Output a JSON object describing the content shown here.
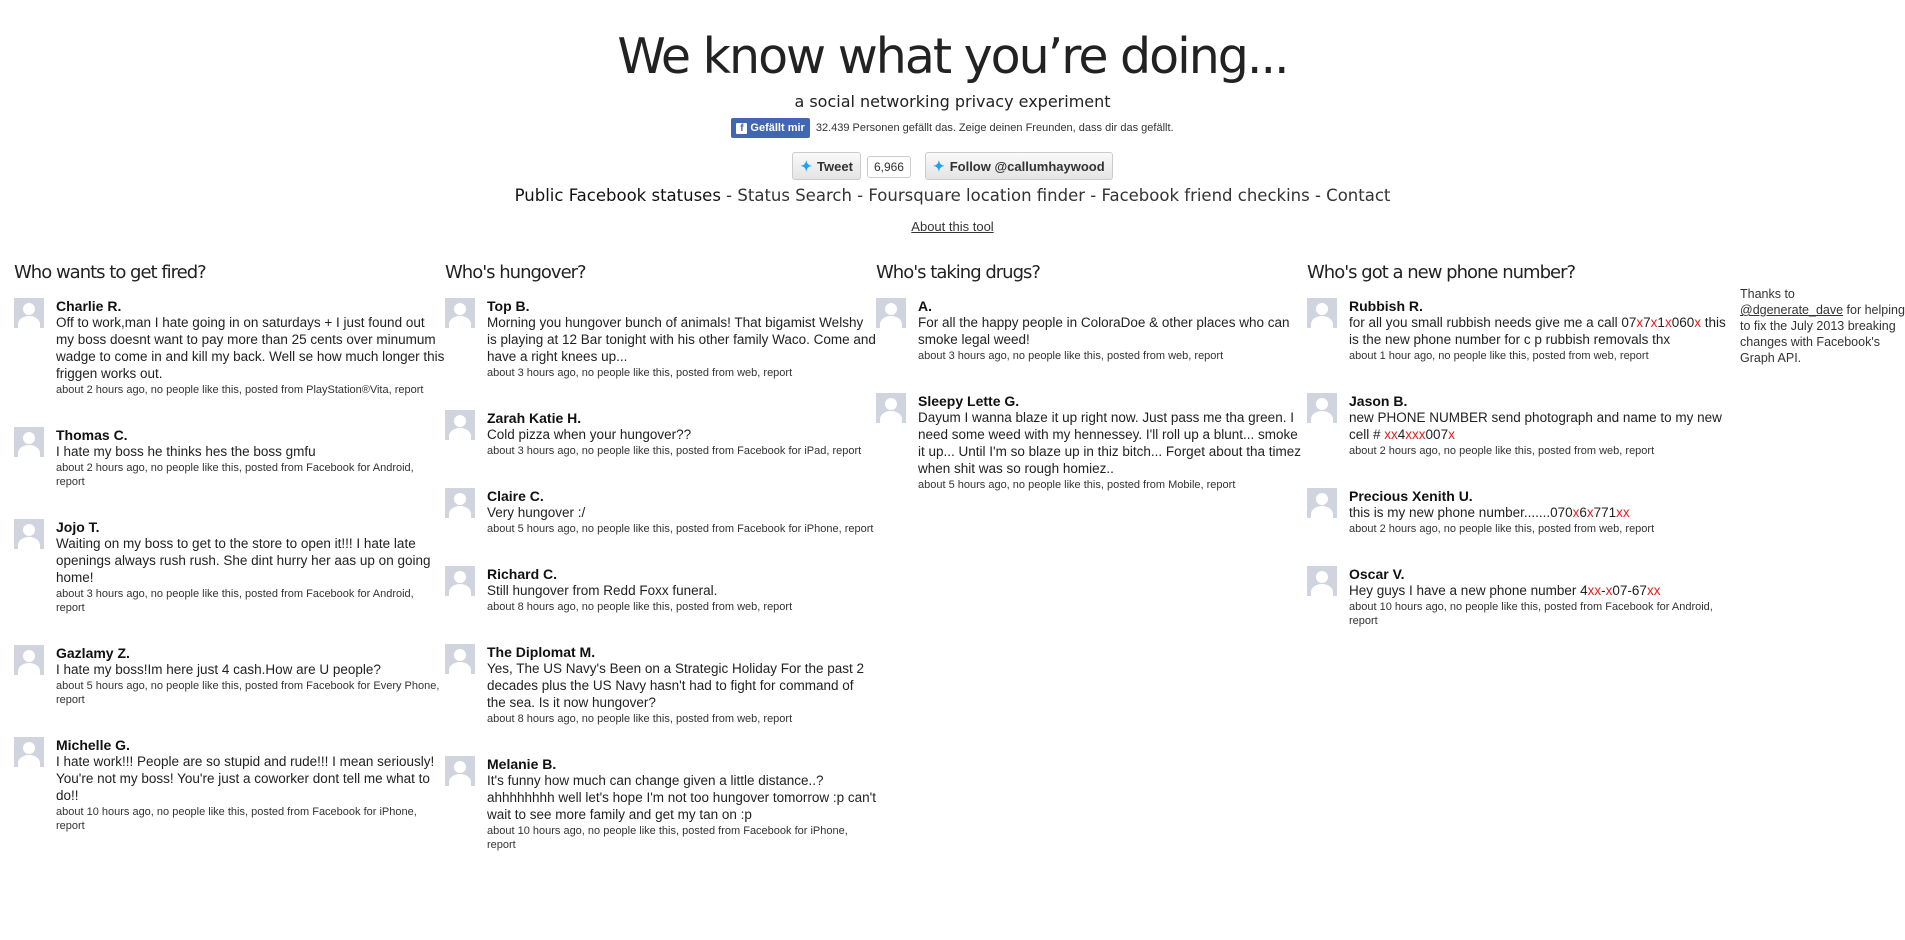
{
  "header": {
    "title": "We know what you’re doing...",
    "subtitle": "a social networking privacy experiment",
    "like_label": "Gefällt mir",
    "like_text": "32.439 Personen gefällt das. Zeige deinen Freunden, dass dir das gefällt.",
    "tweet_label": "Tweet",
    "tweet_count": "6,966",
    "follow_label": "Follow @callumhaywood"
  },
  "nav": {
    "items": [
      "Public Facebook statuses",
      "Status Search",
      "Foursquare location finder",
      "Facebook friend checkins",
      "Contact"
    ],
    "separator": " - "
  },
  "about_link": "About this tool",
  "columns": [
    {
      "title": "Who wants to get fired?",
      "posts": [
        {
          "name": "Charlie R.",
          "status": "Off to work,man I hate going in on saturdays + I just found out my boss doesnt want to pay more than 25 cents over minumum wadge to come in and kill my back. Well se how much longer this friggen works out.",
          "meta": "about 2 hours ago, no people like this, posted from PlayStation®Vita,",
          "report": "report"
        },
        {
          "name": "Thomas C.",
          "status": "I hate my boss he thinks hes the boss gmfu",
          "meta": "about 2 hours ago, no people like this, posted from Facebook for Android,",
          "report": "report"
        },
        {
          "name": "Jojo T.",
          "status": "Waiting on my boss to get to the store to open it!!! I hate late openings always rush rush. She dint hurry her aas up on going home!",
          "meta": "about 3 hours ago, no people like this, posted from Facebook for Android,",
          "report": "report"
        },
        {
          "name": "Gazlamy Z.",
          "status": "I hate my boss!Im here just 4 cash.How are U people?",
          "meta": "about 5 hours ago, no people like this, posted from Facebook for Every Phone,",
          "report": "report"
        },
        {
          "name": "Michelle G.",
          "status": "I hate work!!! People are so stupid and rude!!! I mean seriously! You're not my boss! You're just a coworker dont tell me what to do!!",
          "meta": "about 10 hours ago, no people like this, posted from Facebook for iPhone,",
          "report": "report"
        }
      ]
    },
    {
      "title": "Who's hungover?",
      "posts": [
        {
          "name": "Top B.",
          "status": "Morning you hungover bunch of animals! That bigamist Welshy is playing at 12 Bar tonight with his other family Waco. Come and have a right knees up...",
          "meta": "about 3 hours ago, no people like this, posted from web,",
          "report": "report"
        },
        {
          "name": "Zarah Katie H.",
          "status": "Cold pizza when your hungover??",
          "meta": "about 3 hours ago, no people like this, posted from Facebook for iPad,",
          "report": "report"
        },
        {
          "name": "Claire C.",
          "status": "Very hungover :/",
          "meta": "about 5 hours ago, no people like this, posted from Facebook for iPhone,",
          "report": "report"
        },
        {
          "name": "Richard C.",
          "status": "Still hungover from Redd Foxx funeral.",
          "meta": "about 8 hours ago, no people like this, posted from web,",
          "report": "report"
        },
        {
          "name": "The Diplomat M.",
          "status": "Yes, The US Navy's Been on a Strategic Holiday For the past 2 decades plus the US Navy hasn't had to fight for command of the sea. Is it now hungover?",
          "meta": "about 8 hours ago, no people like this, posted from web,",
          "report": "report"
        },
        {
          "name": "Melanie B.",
          "status": "It's funny how much can change given a little distance..? ahhhhhhhh well let's hope I'm not too hungover tomorrow :p can't wait to see more family and get my tan on :p",
          "meta": "about 10 hours ago, no people like this, posted from Facebook for iPhone,",
          "report": "report"
        }
      ]
    },
    {
      "title": "Who's taking drugs?",
      "posts": [
        {
          "name": "A.",
          "status": "For all the happy people in ColoraDoe & other places who can smoke legal weed!",
          "meta": "about 3 hours ago, no people like this, posted from web,",
          "report": "report"
        },
        {
          "name": "Sleepy Lette G.",
          "status": "Dayum I wanna blaze it up right now. Just pass me tha green. I need some weed with my hennessey. I'll roll up a blunt... smoke it up... Until I'm so blaze up in thiz bitch... Forget about tha timez when shit was so rough homiez..",
          "meta": "about 5 hours ago, no people like this, posted from Mobile,",
          "report": "report"
        }
      ]
    },
    {
      "title": "Who's got a new phone number?",
      "posts": [
        {
          "name": "Rubbish R.",
          "status_parts": [
            [
              "for all you small rubbish needs give me a call 07",
              false
            ],
            [
              "x",
              true
            ],
            [
              "7",
              false
            ],
            [
              "x",
              true
            ],
            [
              "1",
              false
            ],
            [
              "x",
              true
            ],
            [
              "060",
              false
            ],
            [
              "x",
              true
            ],
            [
              " this is the new phone number for c p rubbish removals thx",
              false
            ]
          ],
          "meta": "about 1 hour ago, no people like this, posted from web,",
          "report": "report"
        },
        {
          "name": "Jason B.",
          "status_parts": [
            [
              "new PHONE NUMBER send photograph and name to my new cell # ",
              false
            ],
            [
              "xx",
              true
            ],
            [
              "4",
              false
            ],
            [
              "xxx",
              true
            ],
            [
              "007",
              false
            ],
            [
              "x",
              true
            ]
          ],
          "meta": "about 2 hours ago, no people like this, posted from web,",
          "report": "report"
        },
        {
          "name": "Precious Xenith U.",
          "status_parts": [
            [
              "this is my new phone number.......070",
              false
            ],
            [
              "x",
              true
            ],
            [
              "6",
              false
            ],
            [
              "x",
              true
            ],
            [
              "771",
              false
            ],
            [
              "xx",
              true
            ]
          ],
          "meta": "about 2 hours ago, no people like this, posted from web,",
          "report": "report"
        },
        {
          "name": "Oscar V.",
          "status_parts": [
            [
              "Hey guys I have a new phone number 4",
              false
            ],
            [
              "xx",
              true
            ],
            [
              "-",
              false
            ],
            [
              "x",
              true
            ],
            [
              "07-67",
              false
            ],
            [
              "xx",
              true
            ]
          ],
          "meta": "about 10 hours ago, no people like this, posted from Facebook for Android,",
          "report": "report"
        }
      ]
    }
  ],
  "thanks": {
    "prefix": "Thanks to",
    "link": "@dgenerate_dave",
    "suffix": " for helping to fix the July 2013 breaking changes with Facebook's Graph API."
  },
  "colors": {
    "accent_red": "#e02020",
    "facebook_blue": "#4267b2",
    "twitter_blue": "#1da1f2"
  }
}
